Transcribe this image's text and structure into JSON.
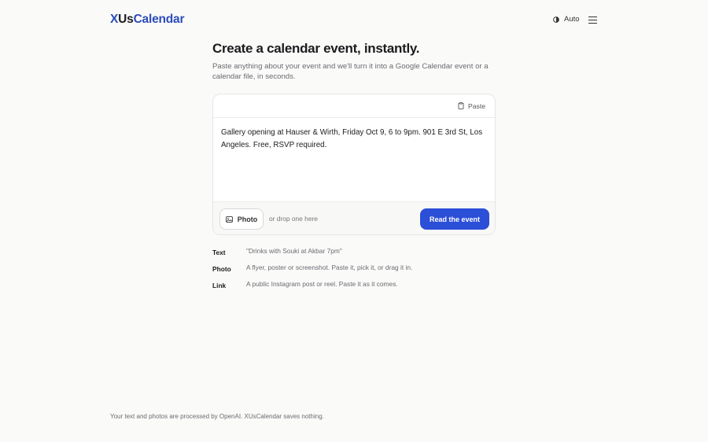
{
  "header": {
    "logo_part1": "X",
    "logo_part2": "Us",
    "logo_part3": "Calendar",
    "theme_label": "Auto"
  },
  "hero": {
    "title": "Create a calendar event, instantly.",
    "subtitle": "Paste anything about your event and we'll turn it into a Google Calendar event or a calendar file, in seconds."
  },
  "input_card": {
    "paste_label": "Paste",
    "text_value": "Gallery opening at Hauser & Wirth, Friday Oct 9, 6 to 9pm. 901 E 3rd St, Los Angeles. Free, RSVP required.",
    "photo_label": "Photo",
    "drop_hint": "or drop one here",
    "submit_label": "Read the event"
  },
  "examples": [
    {
      "label": "Text",
      "description": "\"Drinks with Souki at Akbar 7pm\""
    },
    {
      "label": "Photo",
      "description": "A flyer, poster or screenshot. Paste it, pick it, or drag it in."
    },
    {
      "label": "Link",
      "description": "A public Instagram post or reel. Paste it as it comes."
    }
  ],
  "footer": {
    "text": "Your text and photos are processed by OpenAI. XUsCalendar saves nothing."
  },
  "colors": {
    "accent": "#2c4fd8",
    "logo_blue": "#2c4dba",
    "background": "#fafaf9"
  },
  "icons": {
    "theme": "half-circle-icon",
    "menu": "hamburger-menu-icon",
    "paste": "clipboard-icon",
    "photo": "image-icon"
  }
}
